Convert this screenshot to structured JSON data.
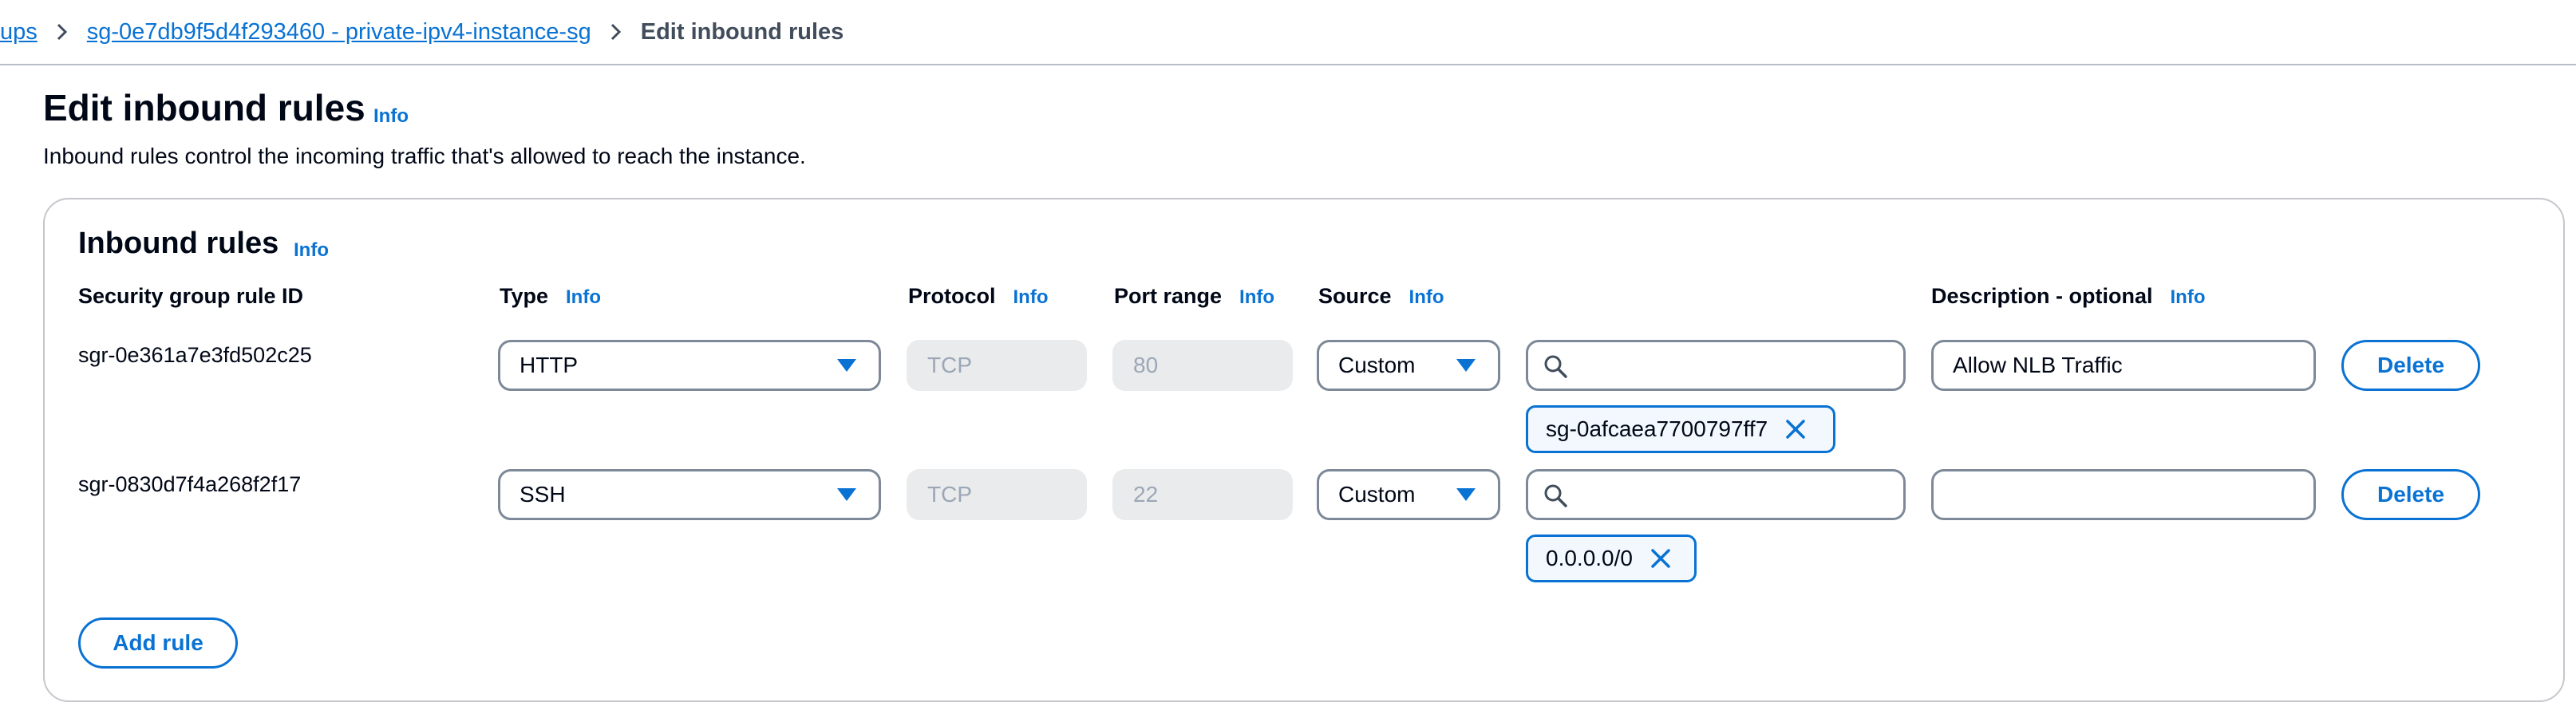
{
  "breadcrumb": {
    "parent_partial": "ups",
    "group": "sg-0e7db9f5d4f293460 - private-ipv4-instance-sg",
    "current": "Edit inbound rules"
  },
  "page": {
    "title": "Edit inbound rules",
    "title_info": "Info",
    "description": "Inbound rules control the incoming traffic that's allowed to reach the instance."
  },
  "panel": {
    "title": "Inbound rules",
    "info": "Info",
    "columns": {
      "rule_id": "Security group rule ID",
      "type": "Type",
      "type_info": "Info",
      "protocol": "Protocol",
      "protocol_info": "Info",
      "port_range": "Port range",
      "port_range_info": "Info",
      "source": "Source",
      "source_info": "Info",
      "description": "Description - optional",
      "description_info": "Info"
    },
    "rules": [
      {
        "id": "sgr-0e361a7e3fd502c25",
        "type": "HTTP",
        "protocol": "TCP",
        "port_range": "80",
        "source": "Custom",
        "search_value": "",
        "token": "sg-0afcaea7700797ff7",
        "description": "Allow NLB Traffic",
        "delete_label": "Delete"
      },
      {
        "id": "sgr-0830d7f4a268f2f17",
        "type": "SSH",
        "protocol": "TCP",
        "port_range": "22",
        "source": "Custom",
        "search_value": "",
        "token": "0.0.0.0/0",
        "description": "",
        "delete_label": "Delete"
      }
    ],
    "add_rule_label": "Add rule"
  },
  "icons": {
    "breadcrumb_separator": "chevron-right-icon",
    "search": "search-icon",
    "remove_token": "close-icon",
    "dropdown": "caret-down-icon"
  },
  "colors": {
    "link": "#0972d3",
    "text": "#000716",
    "border": "#7d8998",
    "disabled_bg": "#e9ebed",
    "disabled_text": "#9ba7b6",
    "token_bg": "#f2f8fd"
  }
}
